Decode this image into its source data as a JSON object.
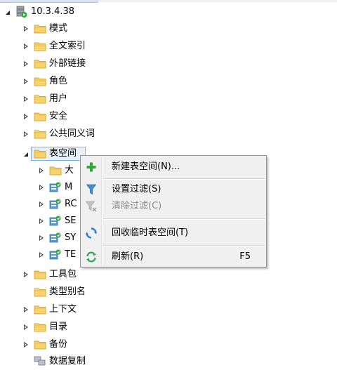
{
  "root": {
    "label": "10.3.4.38",
    "icon": "server-icon"
  },
  "tree_items": [
    {
      "label": "模式",
      "icon": "folder-icon",
      "expander": "closed"
    },
    {
      "label": "全文索引",
      "icon": "folder-icon",
      "expander": "closed"
    },
    {
      "label": "外部链接",
      "icon": "folder-icon",
      "expander": "closed"
    },
    {
      "label": "角色",
      "icon": "folder-icon",
      "expander": "closed"
    },
    {
      "label": "用户",
      "icon": "folder-icon",
      "expander": "closed"
    },
    {
      "label": "安全",
      "icon": "folder-icon",
      "expander": "closed"
    },
    {
      "label": "公共同义词",
      "icon": "folder-icon",
      "expander": "closed"
    },
    {
      "label": "表空间",
      "icon": "folder-icon",
      "expander": "open",
      "selected": true
    }
  ],
  "tablespace_children": [
    {
      "label": "大",
      "icon": "folder-icon"
    },
    {
      "label": "M",
      "icon": "tablespace-icon"
    },
    {
      "label": "RC",
      "icon": "tablespace-icon"
    },
    {
      "label": "SE",
      "icon": "tablespace-icon"
    },
    {
      "label": "SY",
      "icon": "tablespace-icon"
    },
    {
      "label": "TE",
      "icon": "tablespace-icon"
    }
  ],
  "tree_items_after": [
    {
      "label": "工具包",
      "icon": "folder-icon",
      "expander": "closed"
    },
    {
      "label": "类型别名",
      "icon": "folder-icon",
      "expander": "none"
    },
    {
      "label": "上下文",
      "icon": "folder-icon",
      "expander": "closed"
    },
    {
      "label": "目录",
      "icon": "folder-icon",
      "expander": "closed"
    },
    {
      "label": "备份",
      "icon": "folder-icon",
      "expander": "closed"
    },
    {
      "label": "数据复制",
      "icon": "replication-icon",
      "expander": "none"
    }
  ],
  "context_menu": {
    "items": [
      {
        "label": "新建表空间(N)...",
        "icon": "plus-icon",
        "enabled": true,
        "shortcut": ""
      },
      {
        "label": "设置过滤(S)",
        "icon": "filter-icon",
        "enabled": true,
        "shortcut": ""
      },
      {
        "label": "清除过滤(C)",
        "icon": "clear-filter-icon",
        "enabled": false,
        "shortcut": ""
      },
      {
        "label": "回收临时表空间(T)",
        "icon": "recycle-icon",
        "enabled": true,
        "shortcut": ""
      },
      {
        "label": "刷新(R)",
        "icon": "refresh-icon",
        "enabled": true,
        "shortcut": "F5"
      }
    ]
  },
  "colors": {
    "folder": "#f6d36b",
    "folder_edge": "#d9a93a",
    "selection_border": "#7fb2e5",
    "selection_fill": "#e7f1fb",
    "menu_bg": "#f0f0f0",
    "plus": "#2fa83a",
    "filter": "#3f8edb",
    "refresh": "#32a852"
  }
}
